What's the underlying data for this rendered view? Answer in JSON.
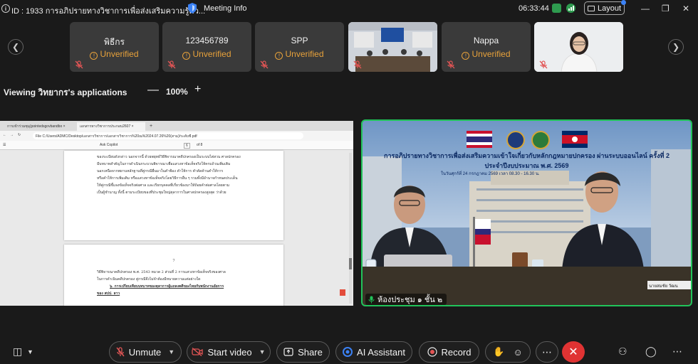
{
  "topbar": {
    "meeting_id": "ID : 1933  การอภิปรายทางวิชาการเพื่อส่งเสริมความรู้คว...",
    "meeting_info_label": "Meeting Info",
    "clock": "06:33:44",
    "layout_label": "Layout"
  },
  "participants": [
    {
      "name": "พิธีกร",
      "status": "Unverified"
    },
    {
      "name": "123456789",
      "status": "Unverified"
    },
    {
      "name": "SPP",
      "status": "Unverified"
    },
    {
      "name": "Nappa",
      "status": "Unverified"
    }
  ],
  "viewing": {
    "label": "Viewing วิทยากร's applications",
    "zoom": "100%"
  },
  "shared_screen": {
    "tab1": "การเข้าร่วมชุมุ(pointedsgovbandbo ×",
    "tab2": "เอกสารทางวิชาการประกอบ2607 ×",
    "url": "File  C:/Users/ADMC/Desktop/เอกสารวิชาการ/เอกสารวิชาการ%20ณ%2024.07.26%20(สาม)/ระดับชี.pdf",
    "ask_copilot": "Ask Copilot",
    "page_current": "6",
    "page_total": "of 8",
    "paragraph_lines": [
      "ของระเบียบดังกล่าว  นอกจากนี้ ด้วยพยุทธ์วิธีพิจารณาคดีปกครองเป็นระบบไต่สวน ศาลปกครอง",
      "มีบทบาทสำคัญในการดำเนินกระบวนพิจารณาเพื่อแสวงหาข้อเท็จจริงให้ครบถ้วนเพิ่มเติม",
      "นอกเหนือจากพยานหลักฐานที่คู่กรณียื่นมาในคำฟ้อง คำให้การ คำคัดค้านคำให้การ",
      "หรือคำให้การเพิ่มเติม  หรือแสวงหาข้อเท็จจริงโดยวิธีการอื่น ๆ รวมทั้งมีอำนาจกำหนดประเด็น",
      "ให้คู่กรณีชี้แจงข้อเท็จจริงต่อศาล และเรียกบุคคลที่เกี่ยวข้องมาให้ถ้อยคำต่อศาลโดยตาม",
      "เป็นผู้ชำนาญ  ทั้งนี้ ตามระเบียบของที่ประชุมใหญ่ตุลาการในศาลปกครองสูงสุด ว่าด้วย"
    ],
    "page_number": "7",
    "page2_lines": [
      "วิธีพิจารณาคดีปกครอง พ.ศ. 2543 หมวด 2 ส่วนที่ 2 การแสวงหาข้อเท็จจริงของศาล",
      "ในการดำเนินคดีปกครอง คู่กรณีจึงไม่จำต้องมีทนายความแต่อย่างใด"
    ],
    "section_heading": "๖. การเปรียบเทียบบทบาทของตุลาการผู้แถลงคดีของไทยกับพนักงานอัยการ",
    "section_heading_2": "ของ สปป. ลาว"
  },
  "speaker": {
    "banner_title": "การอภิปรายทางวิชาการเพื่อส่งเสริมความเข้าใจเกี่ยวกับหลักกฎหมายปกครอง ผ่านระบบออนไลน์ ครั้งที่ 2",
    "banner_sub": "ประจำปีงบประมาณ พ.ศ. 2569",
    "banner_date": "ในวันศุกร์ที่ 24 กรกฎาคม 2569 เวลา 08.30 - 16.30 น.",
    "room_label": "ห้องประชุม ๑ ชั้น ๒",
    "nameplate": "นายสมชัย วัฒน"
  },
  "toolbar": {
    "unmute": "Unmute",
    "start_video": "Start video",
    "share": "Share",
    "ai_assistant": "AI Assistant",
    "record": "Record"
  },
  "colors": {
    "accent_green": "#21c45a",
    "warning_orange": "#e8a23b",
    "end_red": "#e03333"
  }
}
